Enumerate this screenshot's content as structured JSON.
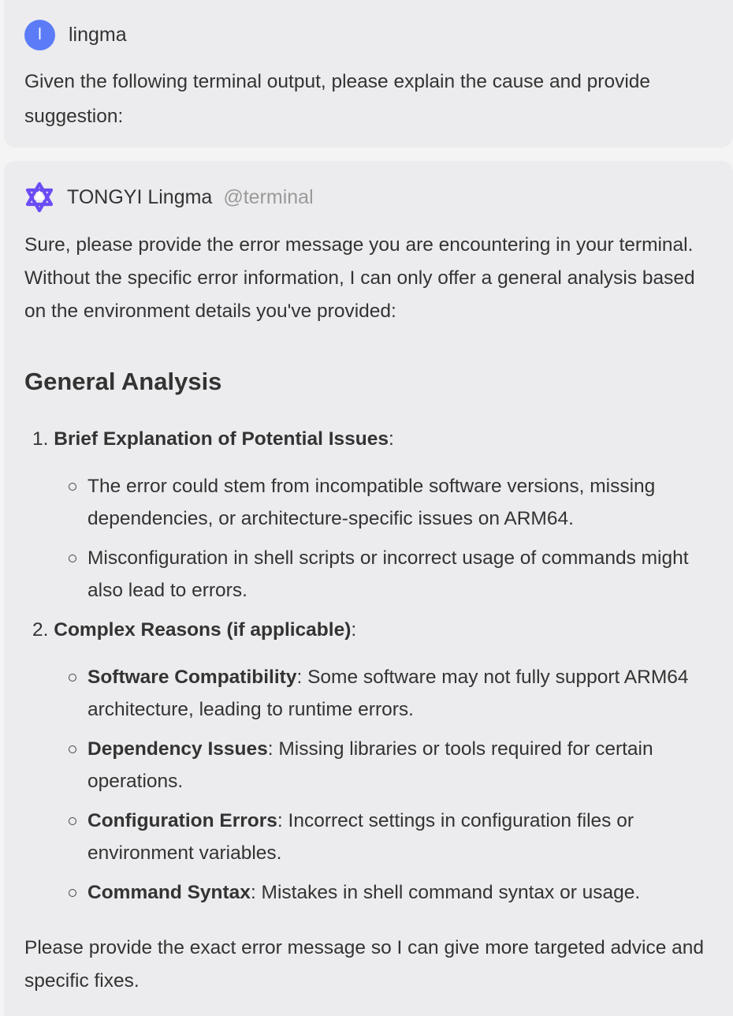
{
  "user": {
    "avatar_initial": "l",
    "name": "lingma",
    "message": "Given the following terminal output, please explain the cause and provide suggestion:"
  },
  "assistant": {
    "name": "TONGYI Lingma",
    "handle": "@terminal",
    "intro": "Sure, please provide the error message you are encountering in your terminal. Without the specific error information, I can only offer a general analysis based on the environment details you've provided:",
    "heading": "General Analysis",
    "sections": [
      {
        "number": "1.",
        "title": "Brief Explanation of Potential Issues",
        "suffix": ":",
        "bullets": [
          {
            "bold": "",
            "text": "The error could stem from incompatible software versions, missing dependencies, or architecture-specific issues on ARM64."
          },
          {
            "bold": "",
            "text": "Misconfiguration in shell scripts or incorrect usage of commands might also lead to errors."
          }
        ]
      },
      {
        "number": "2.",
        "title": "Complex Reasons (if applicable)",
        "suffix": ":",
        "bullets": [
          {
            "bold": "Software Compatibility",
            "text": ": Some software may not fully support ARM64 architecture, leading to runtime errors."
          },
          {
            "bold": "Dependency Issues",
            "text": ": Missing libraries or tools required for certain operations."
          },
          {
            "bold": "Configuration Errors",
            "text": ": Incorrect settings in configuration files or environment variables."
          },
          {
            "bold": "Command Syntax",
            "text": ": Mistakes in shell command syntax or usage."
          }
        ]
      }
    ],
    "closing": "Please provide the exact error message so I can give more targeted advice and specific fixes."
  },
  "colors": {
    "avatar": "#5b7cf6",
    "logo": "#6c4cf5",
    "bubble": "#ececee",
    "handle": "#9a9a9a"
  }
}
